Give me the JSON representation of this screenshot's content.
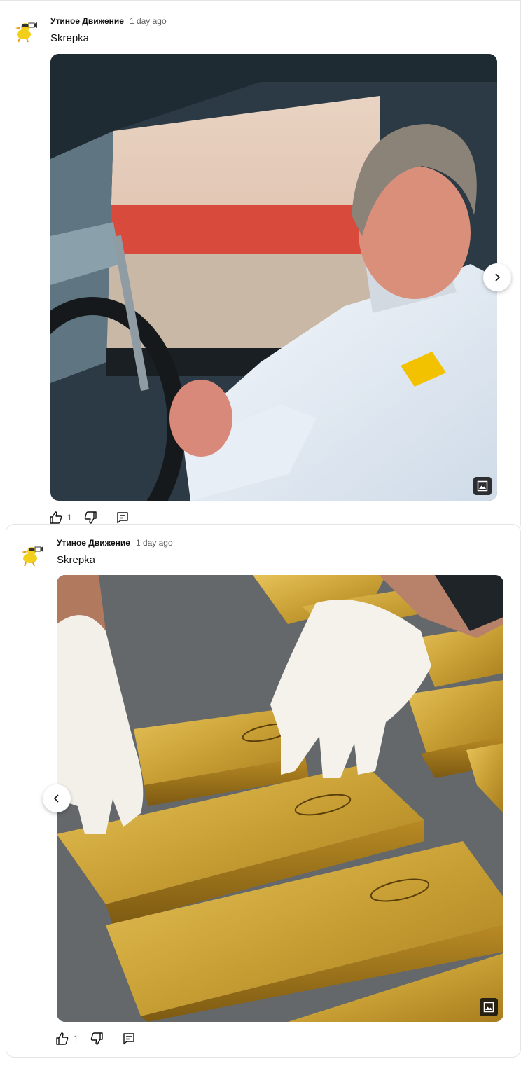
{
  "colors": {
    "text_primary": "#0f0f0f",
    "text_secondary": "#606060",
    "divider": "#e5e5e5",
    "avatar_yellow": "#f2cf1a"
  },
  "posts": [
    {
      "author": "Утиное Движение",
      "time": "1 day ago",
      "text": "Skrepka",
      "likes": "1",
      "image_icon": "image-icon",
      "carousel_arrow": "chevron-right-icon"
    },
    {
      "author": "Утиное Движение",
      "time": "1 day ago",
      "text": "Skrepka",
      "likes": "1",
      "image_icon": "image-icon",
      "carousel_arrow": "chevron-left-icon"
    }
  ]
}
